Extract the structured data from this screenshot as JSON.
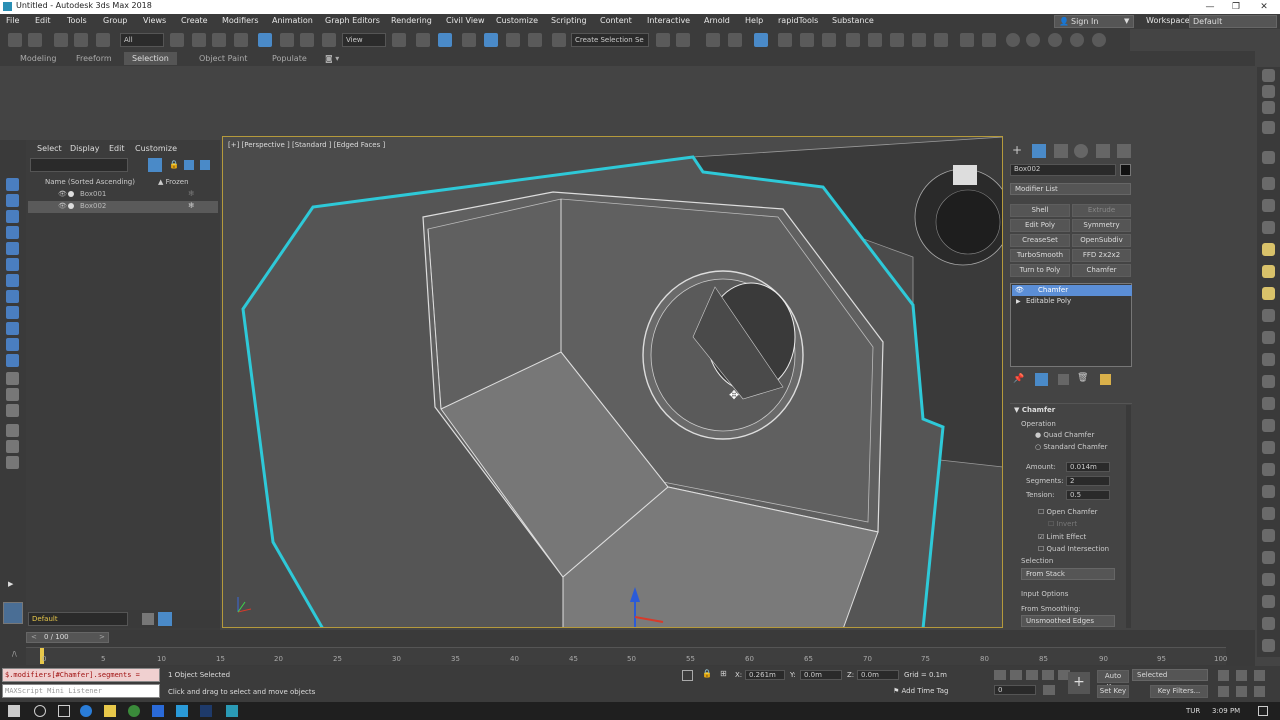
{
  "window": {
    "title": "Untitled - Autodesk 3ds Max 2018"
  },
  "menu": [
    "File",
    "Edit",
    "Tools",
    "Group",
    "Views",
    "Create",
    "Modifiers",
    "Animation",
    "Graph Editors",
    "Rendering",
    "Civil View",
    "Customize",
    "Scripting",
    "Content",
    "Interactive",
    "Arnold",
    "Help",
    "rapidTools",
    "Substance"
  ],
  "account": {
    "sign_in": "Sign In",
    "workspaces_label": "Workspaces:",
    "workspace": "Default"
  },
  "toolbar": {
    "filter": "All",
    "ref_coord": "View",
    "selection_set": "Create Selection Se"
  },
  "ribbon_tabs": [
    "Modeling",
    "Freeform",
    "Selection",
    "Object Paint",
    "Populate"
  ],
  "ribbon_active": "Selection",
  "scene_explorer": {
    "tabs": [
      "Select",
      "Display",
      "Edit",
      "Customize"
    ],
    "col_name": "Name (Sorted Ascending)",
    "col_frozen": "▲ Frozen",
    "rows": [
      {
        "name": "Box001"
      },
      {
        "name": "Box002"
      }
    ],
    "layer": "Default"
  },
  "viewport": {
    "label": "[+] [Perspective ] [Standard ] [Edged Faces ]"
  },
  "command_panel": {
    "object_name": "Box002",
    "modifier_list": "Modifier List",
    "buttons": [
      "Shell",
      "Extrude",
      "Edit Poly",
      "Symmetry",
      "CreaseSet",
      "OpenSubdiv",
      "TurboSmooth",
      "FFD 2x2x2",
      "Turn to Poly",
      "Chamfer"
    ],
    "stack": [
      "Chamfer",
      "Editable Poly"
    ],
    "rollout_title": "Chamfer",
    "operation_label": "Operation",
    "quad_chamfer": "Quad Chamfer",
    "standard_chamfer": "Standard Chamfer",
    "amount_label": "Amount:",
    "amount": "0.014m",
    "segments_label": "Segments:",
    "segments": "2",
    "tension_label": "Tension:",
    "tension": "0.5",
    "open_chamfer": "Open Chamfer",
    "invert": "Invert",
    "limit_effect": "Limit Effect",
    "quad_intersection": "Quad Intersection",
    "selection_label": "Selection",
    "selection_value": "From Stack",
    "input_options": "Input Options",
    "from_smoothing": "From Smoothing:",
    "smoothing_value": "Unsmoothed Edges"
  },
  "timeline": {
    "frame": "0 / 100",
    "ticks": [
      "0",
      "5",
      "10",
      "15",
      "20",
      "25",
      "30",
      "35",
      "40",
      "45",
      "50",
      "55",
      "60",
      "65",
      "70",
      "75",
      "80",
      "85",
      "90",
      "95",
      "100"
    ]
  },
  "status": {
    "maxscript": "$.modifiers[#Chamfer].segments =",
    "listener": "MAXScript Mini Listener",
    "selected": "1 Object Selected",
    "prompt": "Click and drag to select and move objects",
    "x": "0.261m",
    "y": "0.0m",
    "z": "0.0m",
    "grid": "Grid = 0.1m",
    "add_time_tag": "Add Time Tag",
    "auto_key": "Auto Key",
    "selected_dd": "Selected",
    "set_key": "Set Key",
    "key_filters": "Key Filters...",
    "frame_field": "0"
  },
  "taskbar": {
    "lang": "TUR",
    "time": "3:09 PM"
  }
}
